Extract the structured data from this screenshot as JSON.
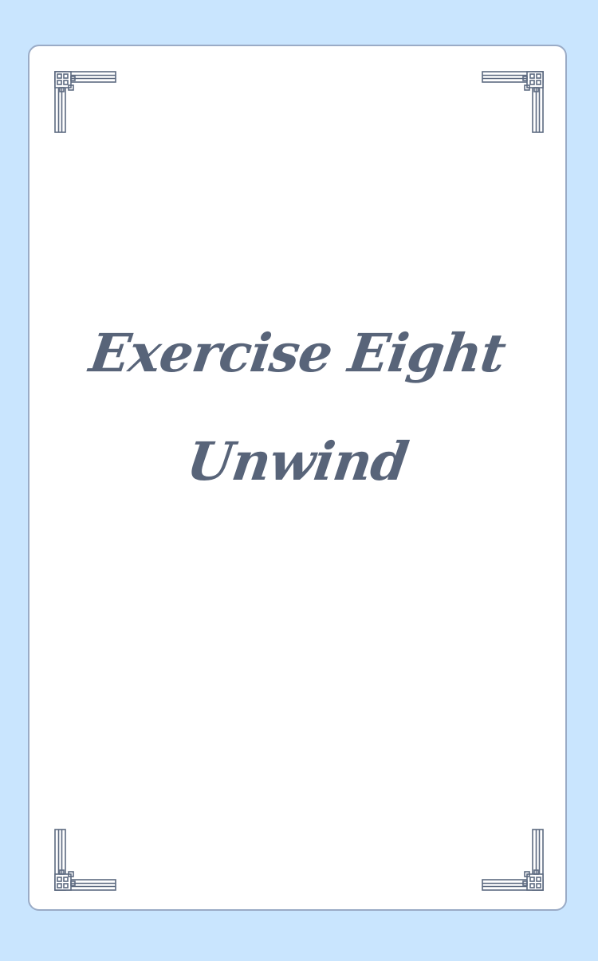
{
  "page": {
    "title_line_1": "Exercise Eight",
    "title_line_2": "Unwind"
  },
  "colors": {
    "background": "#c9e5fe",
    "card": "#ffffff",
    "card_border": "#9aabc6",
    "ornament": "#5d6a80",
    "text": "#586479"
  },
  "decorations": {
    "corner_ornament": "greek-key-corner-icon"
  }
}
